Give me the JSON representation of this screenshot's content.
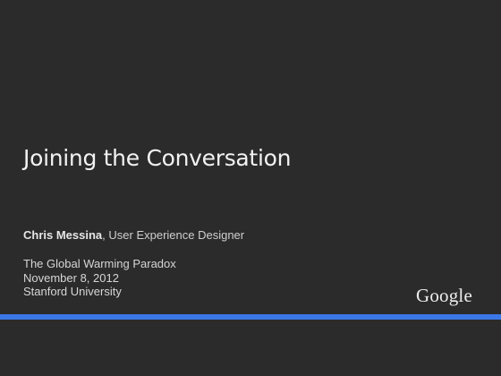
{
  "slide": {
    "title": "Joining the Conversation",
    "presenter_name": "Chris Messina",
    "presenter_role": ", User Experience Designer",
    "event": "The Global Warming Paradox",
    "date": "November 8, 2012",
    "venue": "Stanford University",
    "logo_text": "Google"
  },
  "colors": {
    "background": "#2b2b2b",
    "accent_bar": "#3b78e7"
  }
}
